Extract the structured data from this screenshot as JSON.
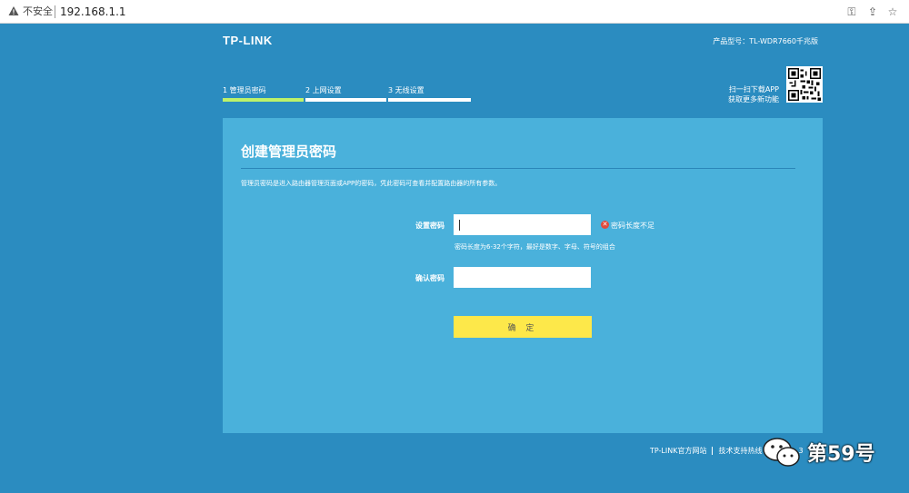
{
  "browser": {
    "security_label": "不安全",
    "url": "192.168.1.1",
    "icons": [
      "warning-icon",
      "key-icon",
      "share-icon",
      "star-icon"
    ]
  },
  "header": {
    "logo": "TP-LINK",
    "model": "产品型号：TL-WDR7660千兆版"
  },
  "steps": [
    {
      "label": "1 管理员密码",
      "active": true
    },
    {
      "label": "2 上网设置",
      "active": false
    },
    {
      "label": "3 无线设置",
      "active": false
    }
  ],
  "app": {
    "line1": "扫一扫下载APP",
    "line2": "获取更多新功能"
  },
  "card": {
    "title": "创建管理员密码",
    "description": "管理员密码是进入路由器管理页面或APP的密码，凭此密码可查看并配置路由器的所有参数。",
    "password_label": "设置密码",
    "password_value": "",
    "password_error": "密码长度不足",
    "password_hint": "密码长度为6-32个字符，最好是数字、字母、符号的组合",
    "confirm_label": "确认密码",
    "confirm_value": "",
    "submit_label": "确 定"
  },
  "footer": {
    "official_site": "TP-LINK官方网站",
    "support": "技术支持热线",
    "support_tail": "3"
  },
  "watermark": {
    "text": "第59号"
  },
  "colors": {
    "page_bg": "#2b8cc0",
    "card_bg": "#4ab1db",
    "active_step": "#bdf26a",
    "button": "#fde84a",
    "error": "#e24a3b"
  }
}
